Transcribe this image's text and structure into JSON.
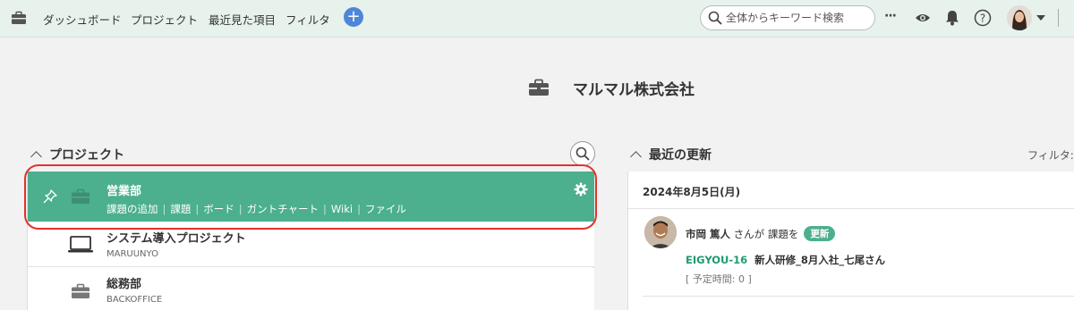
{
  "nav": {
    "home_icon": "briefcase-icon",
    "items": [
      "ダッシュボード",
      "プロジェクト",
      "最近見た項目",
      "フィルタ"
    ],
    "add_label": "+",
    "search_placeholder": "全体からキーワード検索",
    "more_label": "···",
    "icons": [
      "more-icon",
      "eye-icon",
      "bell-icon",
      "help-icon",
      "avatar",
      "caret-down-icon"
    ]
  },
  "org": {
    "name": "マルマル株式会社",
    "icon": "briefcase-icon"
  },
  "projects": {
    "heading": "プロジェクト",
    "items": [
      {
        "name": "営業部",
        "icon": "briefcase-icon",
        "pinned": true,
        "links": [
          "課題の追加",
          "課題",
          "ボード",
          "ガントチャート",
          "Wiki",
          "ファイル"
        ]
      },
      {
        "name": "システム導入プロジェクト",
        "key": "MARUUNYO",
        "icon": "laptop-icon"
      },
      {
        "name": "総務部",
        "key": "BACKOFFICE",
        "icon": "briefcase-icon"
      }
    ]
  },
  "updates": {
    "heading": "最近の更新",
    "filter_label": "フィルタ:",
    "date": "2024年8月5日(月)",
    "entry": {
      "user": "市岡 篤人",
      "action": " さんが 課題を",
      "badge": "更新",
      "issue_key": "EIGYOU-16",
      "issue_title": "新人研修_8月入社_七尾さん",
      "meta": "[ 予定時間: 0 ]"
    }
  },
  "colors": {
    "accent": "#4caf8e",
    "nav_bg": "#e7f2ec",
    "highlight": "#e2322b",
    "add_button": "#4f86d9"
  }
}
